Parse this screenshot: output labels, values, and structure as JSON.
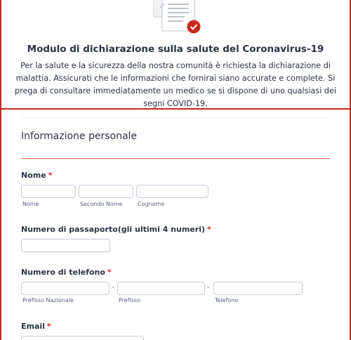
{
  "header": {
    "title": "Modulo di dichiarazione sulla salute del Coronavirus-19",
    "description": "Per la salute e la sicurezza della nostra comunità è richiesta la dichiarazione di malattia. Assicurati che le informazioni che fornirai siano accurate e complete. Si prega di consultare immediatamente un medico se si dispone di uno qualsiasi dei segni COVID-19.",
    "icon": "document-check-icon"
  },
  "section": {
    "title": "Informazione personale"
  },
  "fields": {
    "name": {
      "label": "Nome",
      "required": "*",
      "sublabels": {
        "first": "Nome",
        "middle": "Secondo Nome",
        "last": "Cognome"
      }
    },
    "passport": {
      "label": "Numero di passaporto(gli ultimi 4 numeri)",
      "required": "*"
    },
    "phone": {
      "label": "Numero di telefono",
      "required": "*",
      "separator": "-",
      "sublabels": {
        "country": "Prefisso Nazionale",
        "area": "Prefisso",
        "number": "Telefono"
      }
    },
    "email": {
      "label": "Email",
      "required": "*"
    }
  },
  "colors": {
    "accent": "#c8281c",
    "section_line": "#e0694f",
    "required": "#d92e2e"
  }
}
